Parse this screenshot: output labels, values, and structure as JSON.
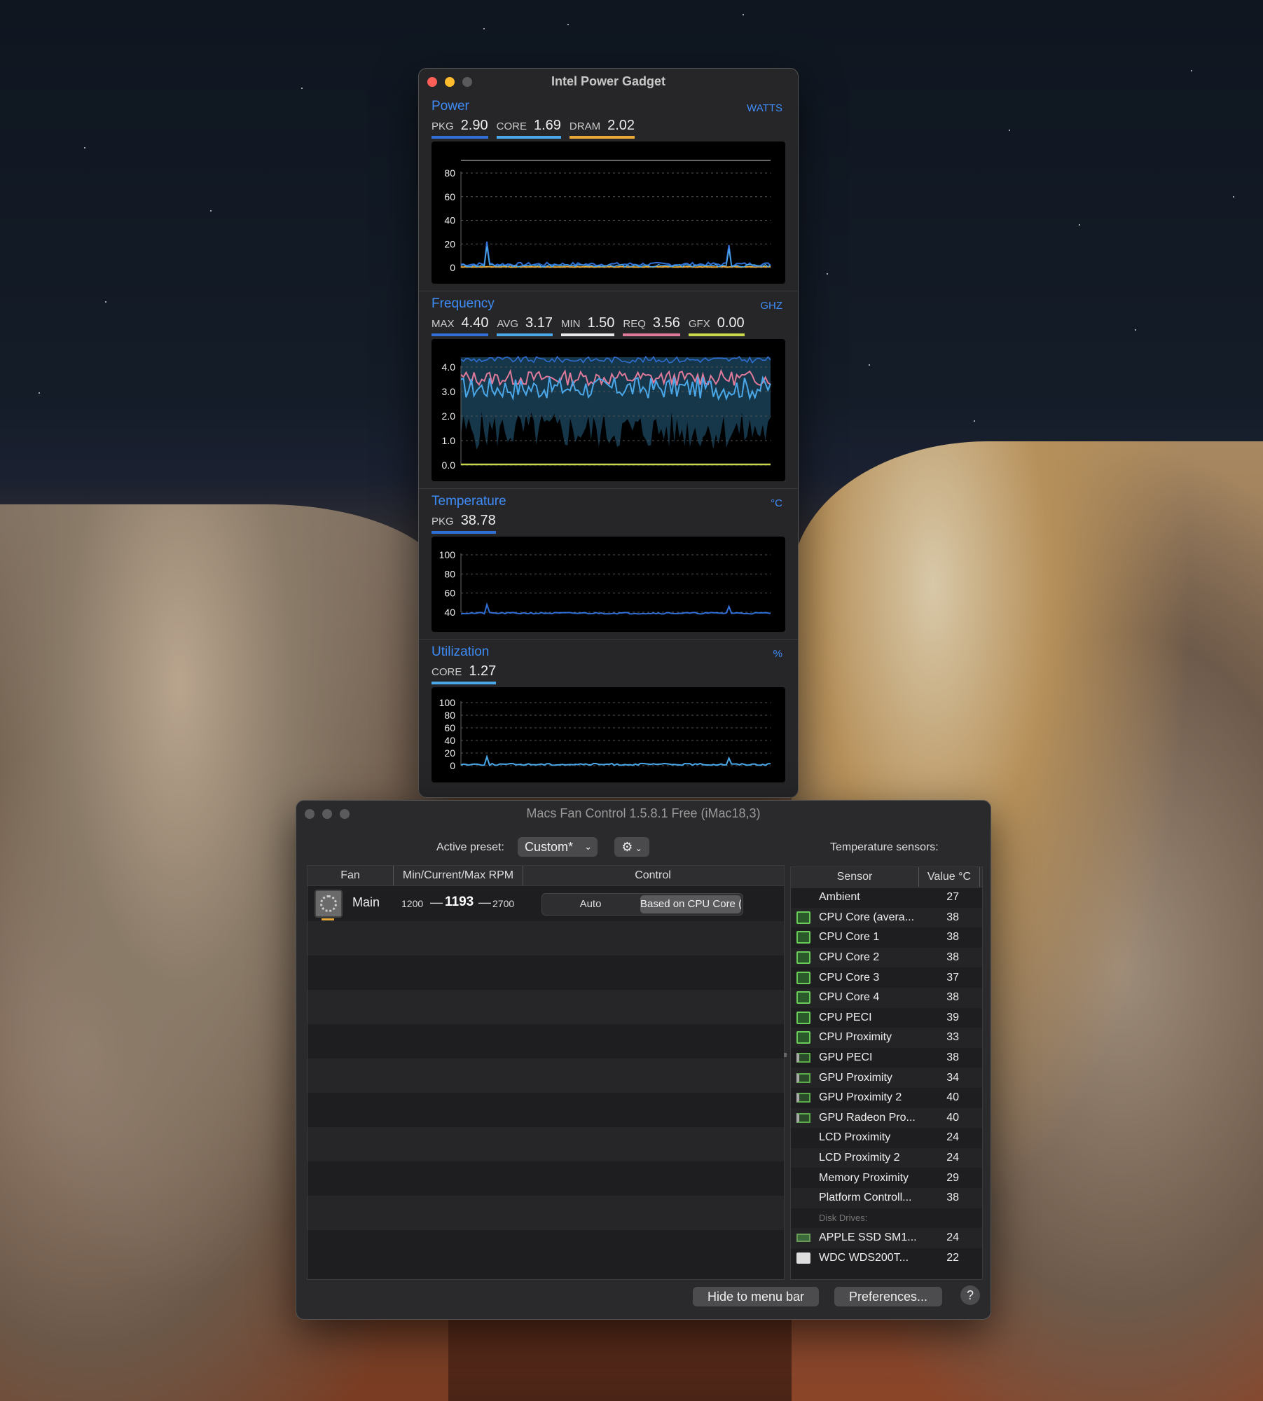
{
  "ipg": {
    "title": "Intel Power Gadget",
    "power": {
      "title": "Power",
      "unit": "WATTS",
      "metrics": [
        {
          "label": "PKG",
          "value": "2.90",
          "color": "#2f6fd6"
        },
        {
          "label": "CORE",
          "value": "1.69",
          "color": "#4aa8e8"
        },
        {
          "label": "DRAM",
          "value": "2.02",
          "color": "#e8a83a"
        }
      ],
      "ticks": [
        "80",
        "60",
        "40",
        "20",
        "0"
      ]
    },
    "frequency": {
      "title": "Frequency",
      "unit": "GHZ",
      "metrics": [
        {
          "label": "MAX",
          "value": "4.40",
          "color": "#2f6fd6"
        },
        {
          "label": "AVG",
          "value": "3.17",
          "color": "#4aa8e8"
        },
        {
          "label": "MIN",
          "value": "1.50",
          "color": "#e8e8e8"
        },
        {
          "label": "REQ",
          "value": "3.56",
          "color": "#e07a9a"
        },
        {
          "label": "GFX",
          "value": "0.00",
          "color": "#c8d84a"
        }
      ],
      "ticks": [
        "4.0",
        "3.0",
        "2.0",
        "1.0",
        "0.0"
      ]
    },
    "temperature": {
      "title": "Temperature",
      "unit": "°C",
      "metrics": [
        {
          "label": "PKG",
          "value": "38.78",
          "color": "#2f6fd6"
        }
      ],
      "ticks": [
        "100",
        "80",
        "60",
        "40"
      ]
    },
    "utilization": {
      "title": "Utilization",
      "unit": "%",
      "metrics": [
        {
          "label": "CORE",
          "value": "1.27",
          "color": "#4aa8e8"
        }
      ],
      "ticks": [
        "100",
        "80",
        "60",
        "40",
        "20",
        "0"
      ]
    }
  },
  "mfc": {
    "title": "Macs Fan Control 1.5.8.1 Free (iMac18,3)",
    "preset_label": "Active preset:",
    "preset_value": "Custom*",
    "temp_sensors_label": "Temperature sensors:",
    "fan_headers": [
      "Fan",
      "Min/Current/Max RPM",
      "Control"
    ],
    "fan": {
      "name": "Main",
      "min": "1200",
      "current": "1193",
      "max": "2700",
      "dash": "—",
      "auto": "Auto",
      "based": "Based on CPU Core (av..."
    },
    "sensor_headers": [
      "Sensor",
      "Value °C"
    ],
    "sensors": [
      {
        "name": "Ambient",
        "value": "27",
        "icon": "none"
      },
      {
        "name": "CPU Core (avera...",
        "value": "38",
        "icon": "cpu"
      },
      {
        "name": "CPU Core 1",
        "value": "38",
        "icon": "cpu"
      },
      {
        "name": "CPU Core 2",
        "value": "38",
        "icon": "cpu"
      },
      {
        "name": "CPU Core 3",
        "value": "37",
        "icon": "cpu"
      },
      {
        "name": "CPU Core 4",
        "value": "38",
        "icon": "cpu"
      },
      {
        "name": "CPU PECI",
        "value": "39",
        "icon": "cpu"
      },
      {
        "name": "CPU Proximity",
        "value": "33",
        "icon": "cpu"
      },
      {
        "name": "GPU PECI",
        "value": "38",
        "icon": "gpu"
      },
      {
        "name": "GPU Proximity",
        "value": "34",
        "icon": "gpu"
      },
      {
        "name": "GPU Proximity 2",
        "value": "40",
        "icon": "gpu"
      },
      {
        "name": "GPU Radeon Pro...",
        "value": "40",
        "icon": "gpu"
      },
      {
        "name": "LCD Proximity",
        "value": "24",
        "icon": "none"
      },
      {
        "name": "LCD Proximity 2",
        "value": "24",
        "icon": "none"
      },
      {
        "name": "Memory Proximity",
        "value": "29",
        "icon": "none"
      },
      {
        "name": "Platform Controll...",
        "value": "38",
        "icon": "none"
      },
      {
        "name": "Disk Drives:",
        "value": "",
        "icon": "group"
      },
      {
        "name": "APPLE SSD SM1...",
        "value": "24",
        "icon": "ssd"
      },
      {
        "name": "WDC  WDS200T...",
        "value": "22",
        "icon": "disk"
      }
    ],
    "hide_button": "Hide to menu bar",
    "prefs_button": "Preferences...",
    "help_button": "?"
  }
}
